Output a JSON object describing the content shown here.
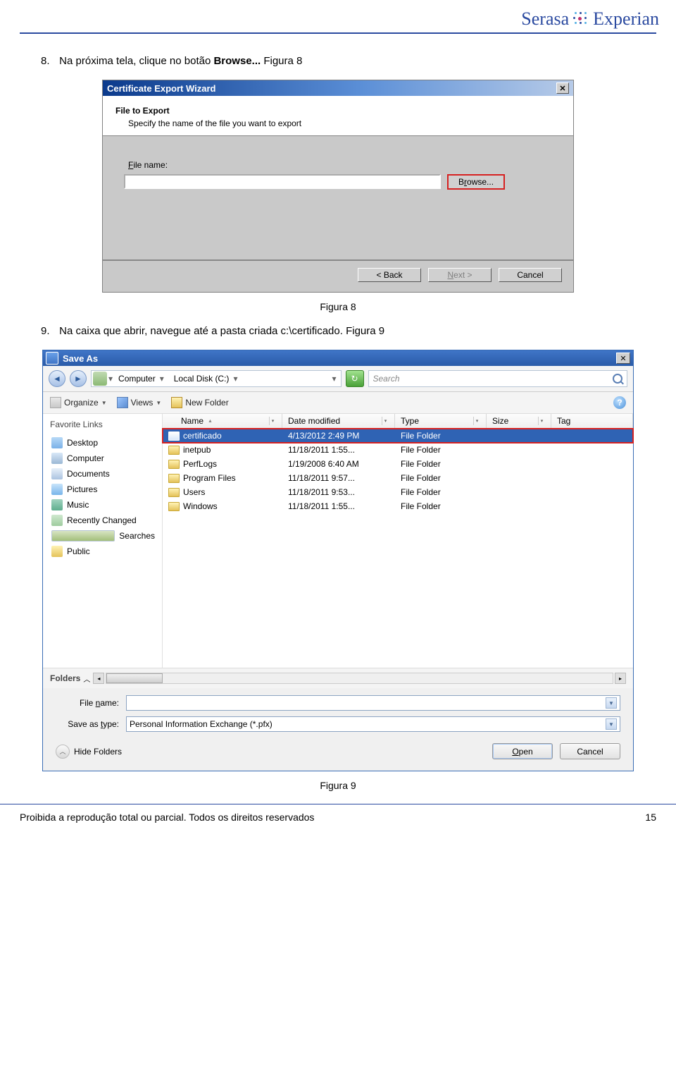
{
  "logo": {
    "serasa": "Serasa",
    "experian": "Experian"
  },
  "step8": {
    "num": "8.",
    "text_before": "Na próxima tela, clique no botão ",
    "bold": "Browse...",
    "text_after": " Figura 8"
  },
  "wizard": {
    "title": "Certificate Export Wizard",
    "head_title": "File to Export",
    "head_sub": "Specify the name of the file you want to export",
    "file_label": "File name:",
    "browse": "Browse...",
    "back": "< Back",
    "next": "Next >",
    "cancel": "Cancel"
  },
  "caption8": "Figura 8",
  "step9": {
    "num": "9.",
    "text": "Na caixa que abrir, navegue até a pasta criada c:\\certificado. Figura 9"
  },
  "saveas": {
    "title": "Save As",
    "crumb": {
      "computer": "Computer",
      "disk": "Local Disk (C:)"
    },
    "search_placeholder": "Search",
    "toolbar": {
      "organize": "Organize",
      "views": "Views",
      "newfolder": "New Folder"
    },
    "fav_title": "Favorite Links",
    "favs": [
      {
        "icon": "desktop",
        "label": "Desktop"
      },
      {
        "icon": "computer",
        "label": "Computer"
      },
      {
        "icon": "doc",
        "label": "Documents"
      },
      {
        "icon": "pic",
        "label": "Pictures"
      },
      {
        "icon": "music",
        "label": "Music"
      },
      {
        "icon": "recent",
        "label": "Recently Changed"
      },
      {
        "icon": "search",
        "label": "Searches"
      },
      {
        "icon": "public",
        "label": "Public"
      }
    ],
    "cols": {
      "name": "Name",
      "date": "Date modified",
      "type": "Type",
      "size": "Size",
      "tag": "Tag"
    },
    "rows": [
      {
        "name": "certificado",
        "date": "4/13/2012 2:49 PM",
        "type": "File Folder",
        "selected": true
      },
      {
        "name": "inetpub",
        "date": "11/18/2011 1:55...",
        "type": "File Folder"
      },
      {
        "name": "PerfLogs",
        "date": "1/19/2008 6:40 AM",
        "type": "File Folder"
      },
      {
        "name": "Program Files",
        "date": "11/18/2011 9:57...",
        "type": "File Folder"
      },
      {
        "name": "Users",
        "date": "11/18/2011 9:53...",
        "type": "File Folder"
      },
      {
        "name": "Windows",
        "date": "11/18/2011 1:55...",
        "type": "File Folder"
      }
    ],
    "folders_label": "Folders",
    "filename_lbl": "File name:",
    "filetype_lbl": "Save as type:",
    "filetype_val": "Personal Information Exchange (*.pfx)",
    "hide_folders": "Hide Folders",
    "open": "Open",
    "cancel": "Cancel"
  },
  "caption9": "Figura 9",
  "footer": {
    "left": "Proibida a reprodução total ou parcial. Todos os direitos reservados",
    "right": "15"
  }
}
